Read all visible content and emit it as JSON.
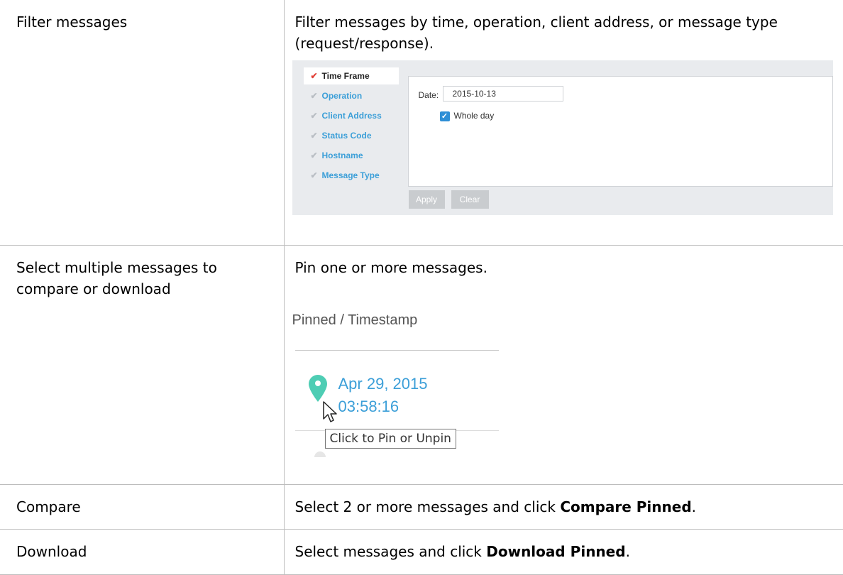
{
  "rows": [
    {
      "feature": "Filter messages",
      "description": "Filter messages by time, operation, client address, or message type (request/response).",
      "screenshot": {
        "menu": [
          "Time Frame",
          "Operation",
          "Client Address",
          "Status Code",
          "Hostname",
          "Message Type"
        ],
        "active_item": "Time Frame",
        "date_label": "Date:",
        "date_value": "2015-10-13",
        "whole_day_label": "Whole day",
        "whole_day_checked": true,
        "apply_label": "Apply",
        "clear_label": "Clear"
      }
    },
    {
      "feature": "Select multiple messages to compare or download",
      "description": "Pin one or more messages.",
      "screenshot": {
        "column_header": "Pinned / Timestamp",
        "date": "Apr 29, 2015",
        "time": "03:58:16",
        "tooltip": "Click to Pin or Unpin"
      }
    },
    {
      "feature": "Compare",
      "description_prefix": "Select 2 or more messages and click ",
      "description_bold": "Compare Pinned",
      "description_suffix": "."
    },
    {
      "feature": "Download",
      "description_prefix": "Select messages and click ",
      "description_bold": "Download Pinned",
      "description_suffix": "."
    }
  ],
  "colors": {
    "link_blue": "#3c9fd8",
    "check_red": "#e2433a",
    "pin_green": "#4ecdb4",
    "checkbox_blue": "#2e8fd6"
  }
}
